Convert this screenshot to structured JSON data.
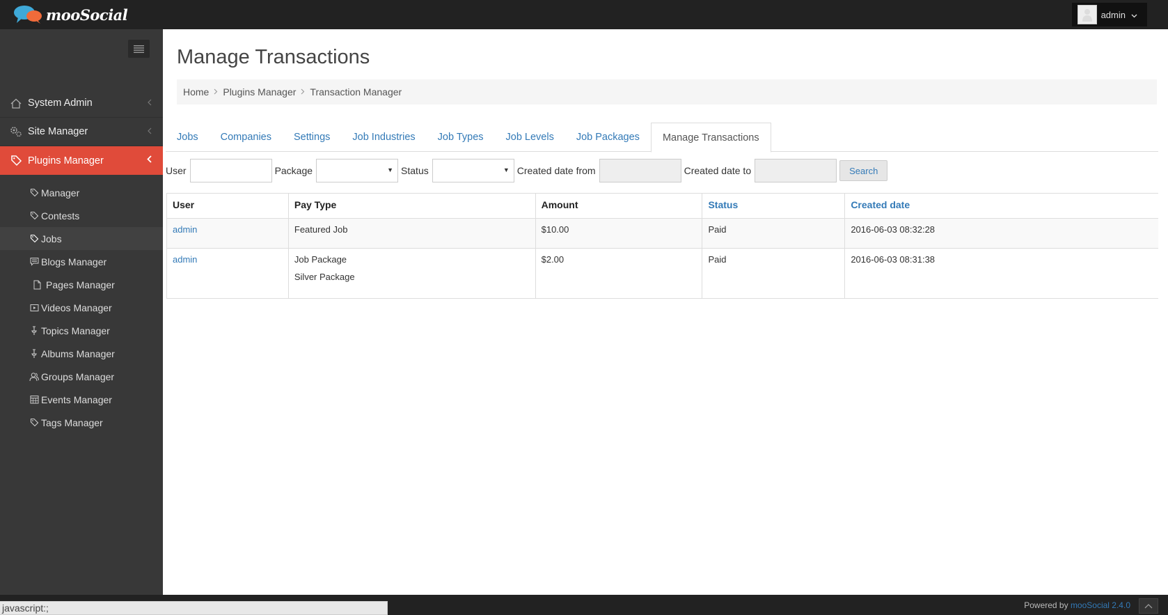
{
  "header": {
    "logo_text": "mooSocial",
    "user_name": "admin",
    "brand_colors": {
      "bubble_blue": "#3fa9d8",
      "bubble_orange": "#f06b3a"
    }
  },
  "sidebar": {
    "menu_toggle_icon": "hamburger-icon",
    "sections": [
      {
        "label": "System Admin",
        "icon": "home-icon"
      },
      {
        "label": "Site Manager",
        "icon": "gears-icon"
      },
      {
        "label": "Plugins Manager",
        "icon": "tag-icon",
        "active": true
      }
    ],
    "sub_items": [
      {
        "label": "Manager",
        "icon": "tag-icon"
      },
      {
        "label": "Contests",
        "icon": "tag-icon"
      },
      {
        "label": "Jobs",
        "icon": "tag-icon",
        "active": true
      },
      {
        "label": "Blogs Manager",
        "icon": "comment-icon"
      },
      {
        "label": "Pages Manager",
        "icon": "page-icon"
      },
      {
        "label": "Videos Manager",
        "icon": "video-icon"
      },
      {
        "label": "Topics Manager",
        "icon": "pin-icon"
      },
      {
        "label": "Albums Manager",
        "icon": "pin-icon"
      },
      {
        "label": "Groups Manager",
        "icon": "group-icon"
      },
      {
        "label": "Events Manager",
        "icon": "calendar-icon"
      },
      {
        "label": "Tags Manager",
        "icon": "tag-icon"
      }
    ],
    "active_color": "#e04b3a"
  },
  "main": {
    "title": "Manage Transactions",
    "breadcrumb": [
      "Home",
      "Plugins Manager",
      "Transaction Manager"
    ],
    "tabs": [
      {
        "label": "Jobs"
      },
      {
        "label": "Companies"
      },
      {
        "label": "Settings"
      },
      {
        "label": "Job Industries"
      },
      {
        "label": "Job Types"
      },
      {
        "label": "Job Levels"
      },
      {
        "label": "Job Packages"
      },
      {
        "label": "Manage Transactions",
        "active": true
      }
    ],
    "filters": {
      "user_label": "User",
      "user_value": "",
      "package_label": "Package",
      "package_value": "",
      "status_label": "Status",
      "status_value": "",
      "date_from_label": "Created date from",
      "date_from_value": "",
      "date_to_label": "Created date to",
      "date_to_value": "",
      "search_label": "Search"
    },
    "table": {
      "columns": [
        "User",
        "Pay Type",
        "Amount",
        "Status",
        "Created date"
      ],
      "rows": [
        {
          "user": "admin",
          "pay_type": [
            "Featured Job"
          ],
          "amount": "$10.00",
          "status": "Paid",
          "created": "2016-06-03 08:32:28"
        },
        {
          "user": "admin",
          "pay_type": [
            "Job Package",
            "Silver Package"
          ],
          "amount": "$2.00",
          "status": "Paid",
          "created": "2016-06-03 08:31:38"
        }
      ]
    }
  },
  "footer": {
    "status_url": "javascript:;",
    "powered_prefix": "Powered by",
    "powered_brand": "mooSocial 2.4.0"
  }
}
